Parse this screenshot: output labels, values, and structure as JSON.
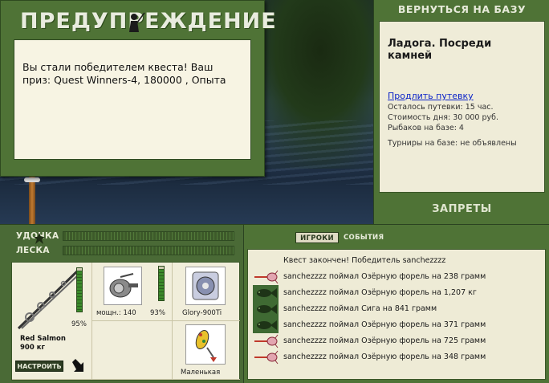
{
  "warning": {
    "title": "ПРЕДУПРЕЖДЕНИЕ",
    "message": "Вы стали победителем квеста! Ваш приз: Quest Winners-4, 180000 , Опыта"
  },
  "right_panel": {
    "back_label": "ВЕРНУТЬСЯ НА БАЗУ",
    "base_name": "Ладога. Посреди камней",
    "extend_link": "Продлить путевку",
    "remaining": "Осталось путевки: 15 час.",
    "day_cost": "Стоимость дня: 30 000 руб.",
    "anglers": "Рыбаков на базе: 4",
    "tournaments": "Турниры на базе: не объявлены",
    "bans_label": "ЗАПРЕТЫ"
  },
  "gear": {
    "rod_label": "УДОЧКА",
    "line_label": "ЛЕСКА",
    "rod_percent": "95%",
    "rod_name": "Red Salmon",
    "rod_weight": "900 кг",
    "setup_label": "НАСТРОИТЬ",
    "reel_power": "мощн.: 140",
    "reel_percent": "93%",
    "line_name": "Glory-900Ti",
    "lure_name": "Маленькая",
    "rod_gauge_level": 0.95,
    "reel_gauge_level": 0.93
  },
  "events": {
    "tab_players": "ИГРОКИ",
    "tab_events": "СОБЫТИЯ",
    "rows": [
      {
        "icon": "none",
        "text": "Квест закончен! Победитель sanchezzzz"
      },
      {
        "icon": "lure-icon",
        "text": "sanchezzzz поймал Озёрную форель на 238 грамм"
      },
      {
        "icon": "fish-icon",
        "text": "sanchezzzz поймал Озёрную форель на 1,207 кг"
      },
      {
        "icon": "fish-icon",
        "text": "sanchezzzz поймал Сига на 841 грамм"
      },
      {
        "icon": "fish-icon",
        "text": "sanchezzzz поймал Озёрную форель на 371 грамм"
      },
      {
        "icon": "lure-icon",
        "text": "sanchezzzz поймал Озёрную форель на 725 грамм"
      },
      {
        "icon": "lure-icon",
        "text": "sanchezzzz поймал Озёрную форель на 348 грамм"
      }
    ]
  },
  "colors": {
    "panel_green": "#4f7336",
    "card_beige": "#efecd8",
    "link_blue": "#0a22c8"
  }
}
